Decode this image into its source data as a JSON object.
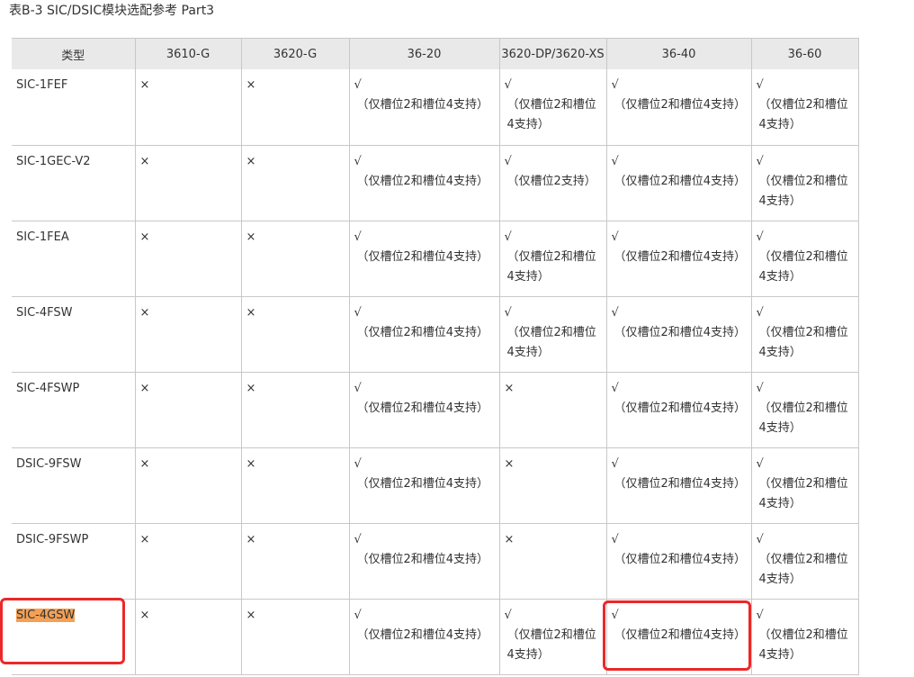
{
  "title": "表B-3 SIC/DSIC模块选配参考 Part3",
  "columns": [
    "类型",
    "3610-G",
    "3620-G",
    "36-20",
    "3620-DP/3620-XS",
    "36-40",
    "36-60"
  ],
  "rows": [
    {
      "type": "SIC-1FEF",
      "cells": [
        {
          "mark": "×",
          "note": ""
        },
        {
          "mark": "×",
          "note": ""
        },
        {
          "mark": "√",
          "note": "（仅槽位2和槽位4支持）"
        },
        {
          "mark": "√",
          "note": "（仅槽位2和槽位4支持）"
        },
        {
          "mark": "√",
          "note": "（仅槽位2和槽位4支持）"
        },
        {
          "mark": "√",
          "note": "（仅槽位2和槽位4支持）"
        }
      ]
    },
    {
      "type": "SIC-1GEC-V2",
      "cells": [
        {
          "mark": "×",
          "note": ""
        },
        {
          "mark": "×",
          "note": ""
        },
        {
          "mark": "√",
          "note": "（仅槽位2和槽位4支持）"
        },
        {
          "mark": "√",
          "note": "（仅槽位2支持）"
        },
        {
          "mark": "√",
          "note": "（仅槽位2和槽位4支持）"
        },
        {
          "mark": "√",
          "note": "（仅槽位2和槽位4支持）"
        }
      ]
    },
    {
      "type": "SIC-1FEA",
      "cells": [
        {
          "mark": "×",
          "note": ""
        },
        {
          "mark": "×",
          "note": ""
        },
        {
          "mark": "√",
          "note": "（仅槽位2和槽位4支持）"
        },
        {
          "mark": "√",
          "note": "（仅槽位2和槽位4支持）"
        },
        {
          "mark": "√",
          "note": "（仅槽位2和槽位4支持）"
        },
        {
          "mark": "√",
          "note": "（仅槽位2和槽位4支持）"
        }
      ]
    },
    {
      "type": "SIC-4FSW",
      "cells": [
        {
          "mark": "×",
          "note": ""
        },
        {
          "mark": "×",
          "note": ""
        },
        {
          "mark": "√",
          "note": "（仅槽位2和槽位4支持）"
        },
        {
          "mark": "√",
          "note": "（仅槽位2和槽位4支持）"
        },
        {
          "mark": "√",
          "note": "（仅槽位2和槽位4支持）"
        },
        {
          "mark": "√",
          "note": "（仅槽位2和槽位4支持）"
        }
      ]
    },
    {
      "type": "SIC-4FSWP",
      "cells": [
        {
          "mark": "×",
          "note": ""
        },
        {
          "mark": "×",
          "note": ""
        },
        {
          "mark": "√",
          "note": "（仅槽位2和槽位4支持）"
        },
        {
          "mark": "×",
          "note": ""
        },
        {
          "mark": "√",
          "note": "（仅槽位2和槽位4支持）"
        },
        {
          "mark": "√",
          "note": "（仅槽位2和槽位4支持）"
        }
      ]
    },
    {
      "type": "DSIC-9FSW",
      "cells": [
        {
          "mark": "×",
          "note": ""
        },
        {
          "mark": "×",
          "note": ""
        },
        {
          "mark": "√",
          "note": "（仅槽位2和槽位4支持）"
        },
        {
          "mark": "×",
          "note": ""
        },
        {
          "mark": "√",
          "note": "（仅槽位2和槽位4支持）"
        },
        {
          "mark": "√",
          "note": "（仅槽位2和槽位4支持）"
        }
      ]
    },
    {
      "type": "DSIC-9FSWP",
      "cells": [
        {
          "mark": "×",
          "note": ""
        },
        {
          "mark": "×",
          "note": ""
        },
        {
          "mark": "√",
          "note": "（仅槽位2和槽位4支持）"
        },
        {
          "mark": "×",
          "note": ""
        },
        {
          "mark": "√",
          "note": "（仅槽位2和槽位4支持）"
        },
        {
          "mark": "√",
          "note": "（仅槽位2和槽位4支持）"
        }
      ]
    },
    {
      "type": "SIC-4GSW",
      "highlighted": true,
      "cells": [
        {
          "mark": "×",
          "note": ""
        },
        {
          "mark": "×",
          "note": ""
        },
        {
          "mark": "√",
          "note": "（仅槽位2和槽位4支持）"
        },
        {
          "mark": "√",
          "note": "（仅槽位2和槽位4支持）"
        },
        {
          "mark": "√",
          "note": "（仅槽位2和槽位4支持）"
        },
        {
          "mark": "√",
          "note": "（仅槽位2和槽位4支持）"
        }
      ]
    }
  ],
  "colors": {
    "header_bg": "#e9e9e9",
    "grid": "#c8c8c8",
    "highlight": "#f5a055",
    "annotation_box": "#ec2828"
  }
}
